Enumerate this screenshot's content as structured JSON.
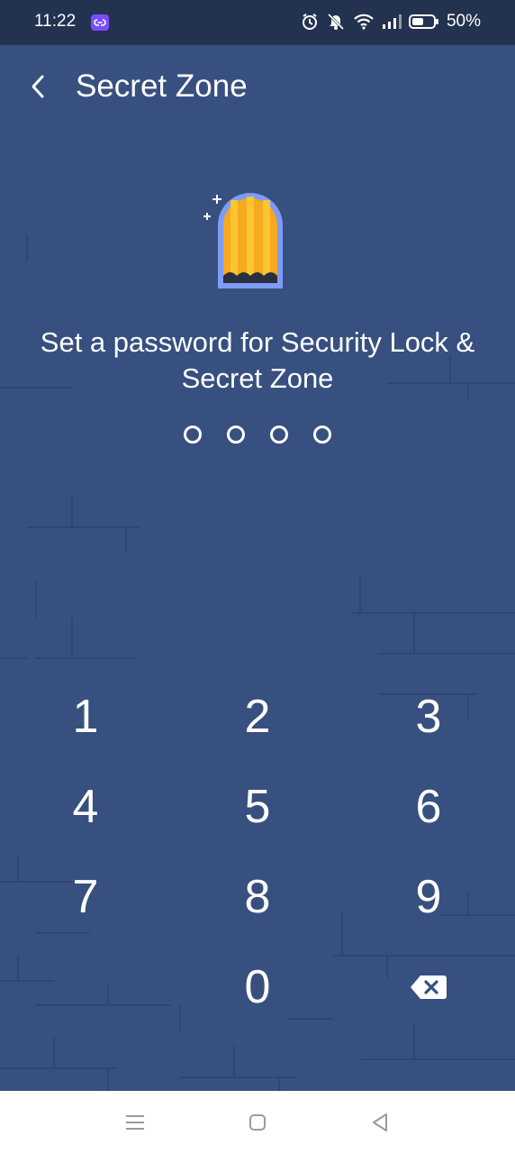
{
  "status_bar": {
    "time": "11:22",
    "battery_percent": "50%",
    "icons": [
      "app-link-icon",
      "alarm-icon",
      "mute-icon",
      "wifi-icon",
      "signal-icon",
      "battery-icon"
    ]
  },
  "header": {
    "title": "Secret Zone",
    "back_icon": "chevron-left-icon"
  },
  "illustration": "door-icon",
  "prompt": {
    "line1": "Set a password for Security Lock &",
    "line2": "Secret Zone"
  },
  "pin": {
    "length": 4,
    "filled": 0
  },
  "keypad": {
    "keys": [
      "1",
      "2",
      "3",
      "4",
      "5",
      "6",
      "7",
      "8",
      "9",
      "0"
    ],
    "delete_icon": "backspace-icon"
  },
  "nav_bar": {
    "icons": [
      "menu-icon",
      "home-icon",
      "back-triangle-icon"
    ]
  },
  "colors": {
    "background": "#37507f",
    "status_bar": "#23324f",
    "door_orange": "#f7a920",
    "door_frame": "#7f9cf5"
  }
}
